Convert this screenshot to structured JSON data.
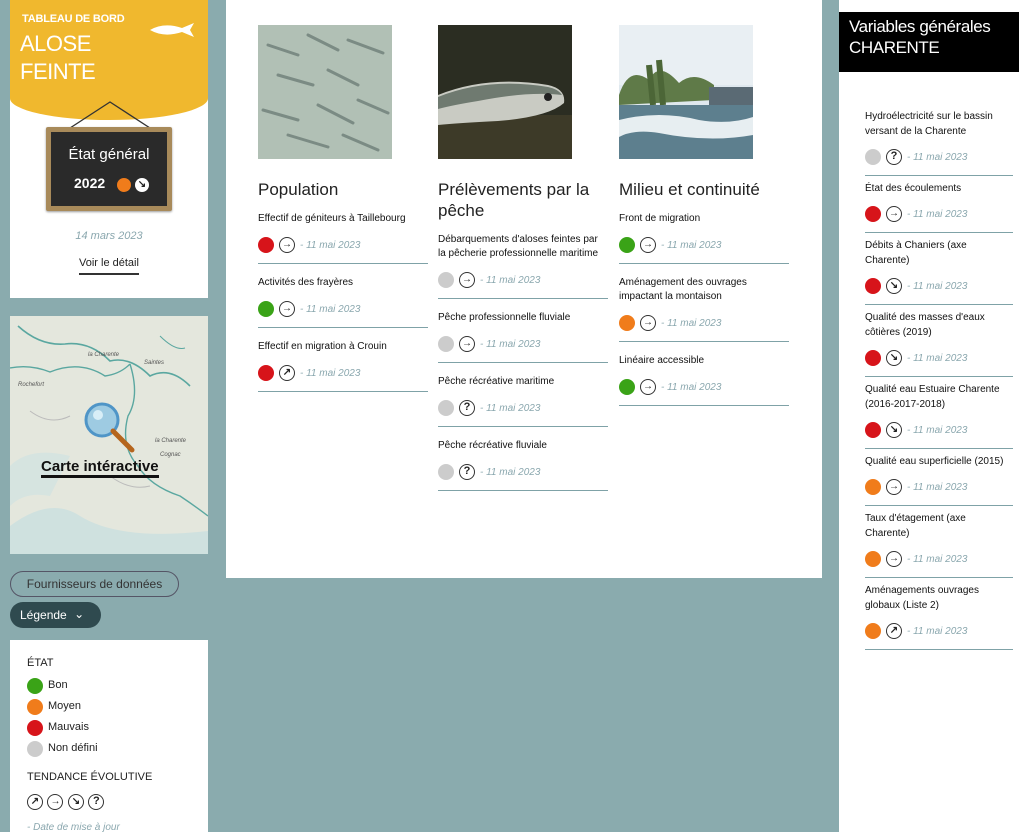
{
  "brand": {
    "subtitle": "TABLEAU DE BORD",
    "title_line1": "ALOSE",
    "title_line2": "FEINTE"
  },
  "board": {
    "title": "État général",
    "year": "2022",
    "status_color": "#f07c1b",
    "trend_icon": "arrow-down-right-icon"
  },
  "left": {
    "date": "14 mars 2023",
    "detail_link": "Voir le détail"
  },
  "map": {
    "label": "Carte intéractive",
    "towns": [
      "la Charente",
      "Saintes",
      "la Charente",
      "Rochefort",
      "Cognac"
    ]
  },
  "buttons": {
    "providers": "Fournisseurs de données",
    "legend": "Légende"
  },
  "legend": {
    "state_heading": "ÉTAT",
    "states": [
      {
        "label": "Bon",
        "color": "#3aa317"
      },
      {
        "label": "Moyen",
        "color": "#f07c1b"
      },
      {
        "label": "Mauvais",
        "color": "#d7141a"
      },
      {
        "label": "Non défini",
        "color": "#cccccc"
      }
    ],
    "trend_heading": "TENDANCE ÉVOLUTIVE",
    "trends": [
      "↗",
      "→",
      "↘",
      "?"
    ],
    "date_note": "- Date de mise à jour"
  },
  "center": {
    "columns": [
      {
        "title": "Population",
        "items": [
          {
            "title": "Effectif de géniteurs à Taillebourg",
            "color": "#d7141a",
            "trend": "→",
            "date": "- 11 mai 2023"
          },
          {
            "title": "Activités des frayères",
            "color": "#3aa317",
            "trend": "→",
            "date": "- 11 mai 2023"
          },
          {
            "title": "Effectif en migration à Crouin",
            "color": "#d7141a",
            "trend": "↗",
            "date": "- 11 mai 2023"
          }
        ]
      },
      {
        "title": "Prélèvements par la pêche",
        "items": [
          {
            "title": "Débarquements d'aloses feintes par la pêcherie professionnelle maritime",
            "color": "#cccccc",
            "trend": "→",
            "date": "- 11 mai 2023"
          },
          {
            "title": "Pêche professionnelle fluviale",
            "color": "#cccccc",
            "trend": "→",
            "date": "- 11 mai 2023"
          },
          {
            "title": "Pêche récréative maritime",
            "color": "#cccccc",
            "trend": "?",
            "date": "- 11 mai 2023"
          },
          {
            "title": "Pêche récréative fluviale",
            "color": "#cccccc",
            "trend": "?",
            "date": "- 11 mai 2023"
          }
        ]
      },
      {
        "title": "Milieu et continuité",
        "items": [
          {
            "title": "Front de migration",
            "color": "#3aa317",
            "trend": "→",
            "date": "- 11 mai 2023"
          },
          {
            "title": "Aménagement des ouvrages impactant la montaison",
            "color": "#f07c1b",
            "trend": "→",
            "date": "- 11 mai 2023"
          },
          {
            "title": "Linéaire accessible",
            "color": "#3aa317",
            "trend": "→",
            "date": "- 11 mai 2023"
          }
        ]
      }
    ]
  },
  "right": {
    "heading_line1": "Variables générales",
    "heading_line2": "CHARENTE",
    "items": [
      {
        "title": "Hydroélectricité sur le bassin versant de la Charente",
        "color": "#cccccc",
        "trend": "?",
        "date": "- 11 mai 2023"
      },
      {
        "title": "État des écoulements",
        "color": "#d7141a",
        "trend": "→",
        "date": "- 11 mai 2023"
      },
      {
        "title": "Débits à Chaniers (axe Charente)",
        "color": "#d7141a",
        "trend": "↘",
        "date": "- 11 mai 2023"
      },
      {
        "title": "Qualité des masses d'eaux côtières (2019)",
        "color": "#d7141a",
        "trend": "↘",
        "date": "- 11 mai 2023"
      },
      {
        "title": "Qualité eau Estuaire Charente (2016-2017-2018)",
        "color": "#d7141a",
        "trend": "↘",
        "date": "- 11 mai 2023"
      },
      {
        "title": "Qualité eau superficielle (2015)",
        "color": "#f07c1b",
        "trend": "→",
        "date": "- 11 mai 2023"
      },
      {
        "title": "Taux d'étagement (axe Charente)",
        "color": "#f07c1b",
        "trend": "→",
        "date": "- 11 mai 2023"
      },
      {
        "title": "Aménagements ouvrages globaux (Liste 2)",
        "color": "#f07c1b",
        "trend": "↗",
        "date": "- 11 mai 2023"
      }
    ]
  }
}
